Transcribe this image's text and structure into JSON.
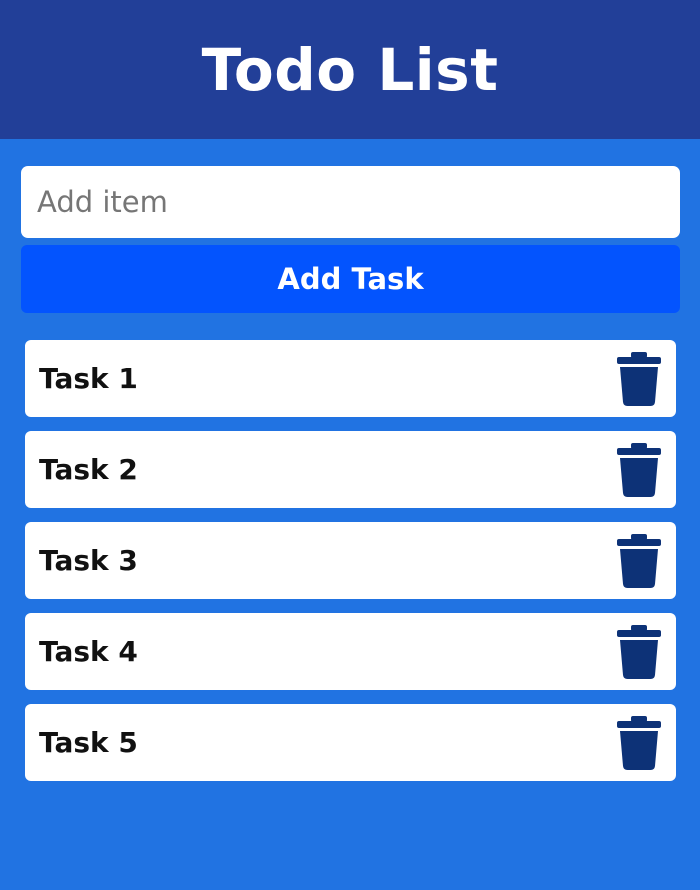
{
  "header": {
    "title": "Todo List"
  },
  "form": {
    "input_value": "",
    "input_placeholder": "Add item",
    "add_button_label": "Add Task"
  },
  "tasks": [
    {
      "label": "Task 1",
      "delete_icon": "trash-icon"
    },
    {
      "label": "Task 2",
      "delete_icon": "trash-icon"
    },
    {
      "label": "Task 3",
      "delete_icon": "trash-icon"
    },
    {
      "label": "Task 4",
      "delete_icon": "trash-icon"
    },
    {
      "label": "Task 5",
      "delete_icon": "trash-icon"
    }
  ],
  "colors": {
    "background": "#2173e2",
    "header": "#223f98",
    "button": "#0354fe",
    "trash_icon": "#0d3277"
  }
}
